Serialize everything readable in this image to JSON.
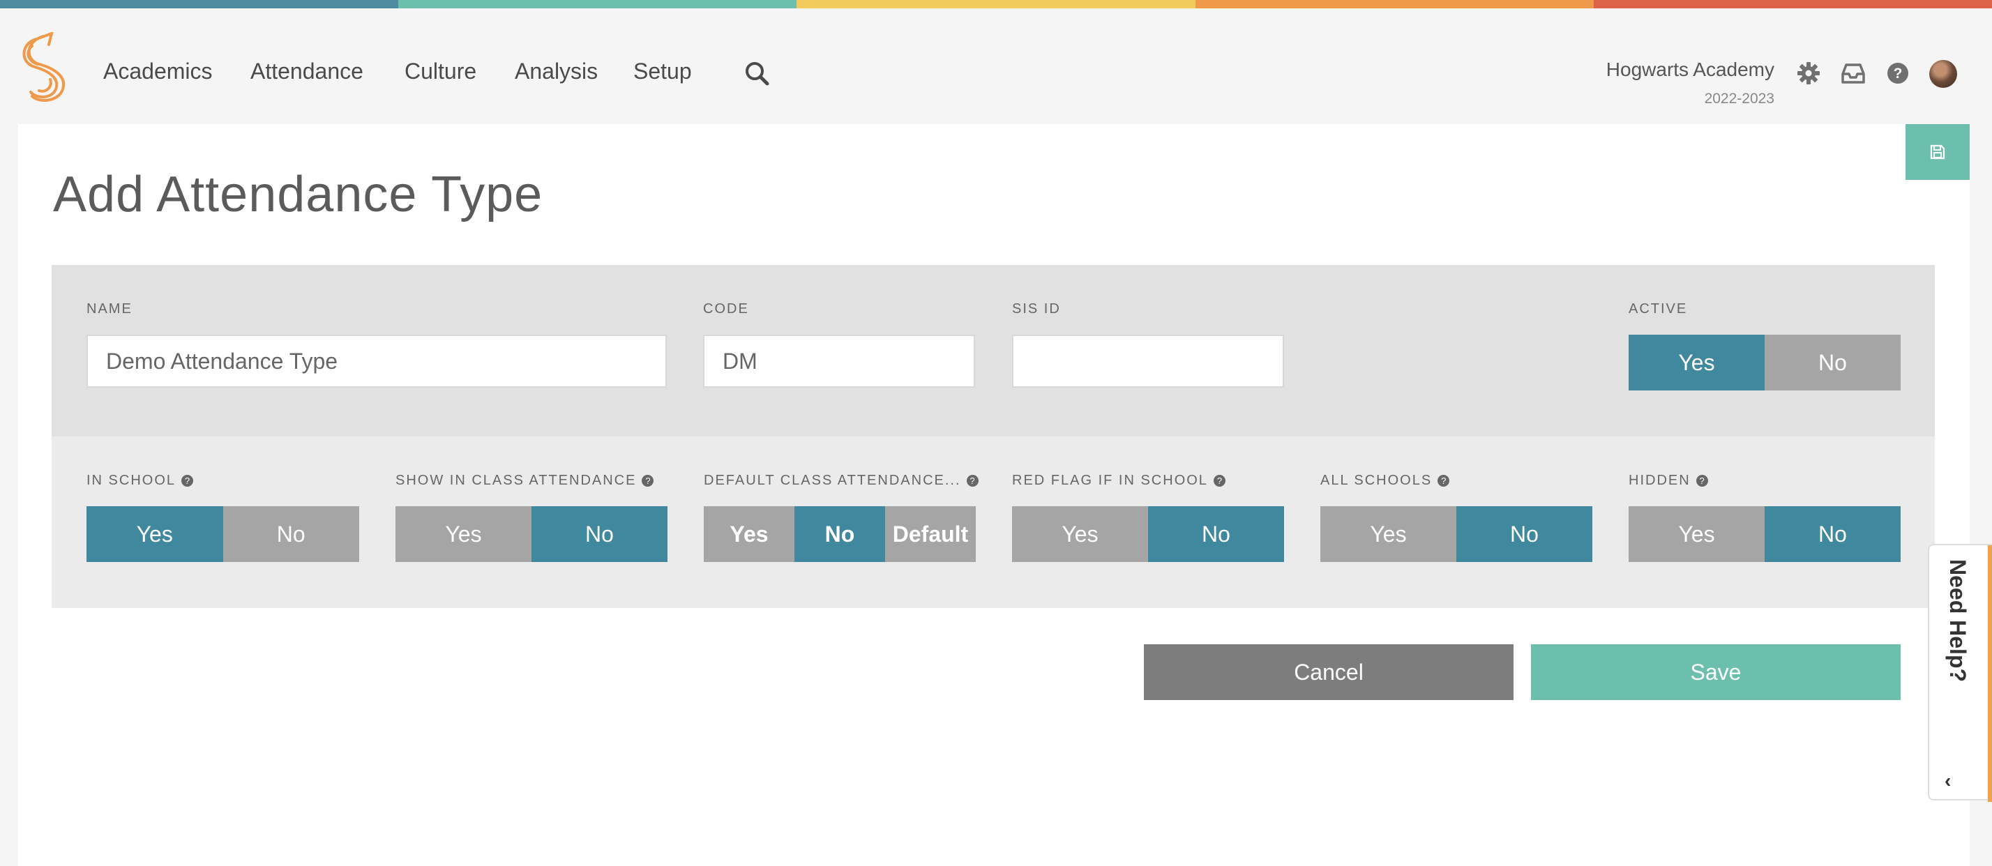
{
  "colors": {
    "stripe": [
      "#4e8aa0",
      "#6dbfad",
      "#f2cb5f",
      "#ef9a4a",
      "#dd6248"
    ],
    "accent_teal": "#3f889e",
    "save_green": "#6dbfad",
    "toggle_off": "#a5a5a5",
    "logo_orange": "#ef9a4a"
  },
  "nav": {
    "items": [
      {
        "label": "Academics"
      },
      {
        "label": "Attendance"
      },
      {
        "label": "Culture"
      },
      {
        "label": "Analysis"
      },
      {
        "label": "Setup"
      }
    ],
    "search_icon": "search-icon",
    "school_name": "Hogwarts Academy",
    "school_year": "2022-2023",
    "tools": [
      "gear-icon",
      "inbox-icon",
      "help-circle-icon",
      "avatar"
    ]
  },
  "page": {
    "title": "Add Attendance Type",
    "save_icon": "floppy-disk-icon"
  },
  "form": {
    "name": {
      "label": "NAME",
      "value": "Demo Attendance Type"
    },
    "code": {
      "label": "CODE",
      "value": "DM"
    },
    "sis_id": {
      "label": "SIS ID",
      "value": ""
    },
    "active": {
      "label": "ACTIVE",
      "options": [
        "Yes",
        "No"
      ],
      "selected": "Yes"
    },
    "in_school": {
      "label": "IN SCHOOL",
      "options": [
        "Yes",
        "No"
      ],
      "selected": "Yes"
    },
    "show_in_class": {
      "label": "SHOW IN CLASS ATTENDANCE",
      "options": [
        "Yes",
        "No"
      ],
      "selected": "No"
    },
    "default_class": {
      "label": "DEFAULT CLASS ATTENDANCE...",
      "options": [
        "Yes",
        "No",
        "Default"
      ],
      "selected": "No"
    },
    "red_flag": {
      "label": "RED FLAG IF IN SCHOOL",
      "options": [
        "Yes",
        "No"
      ],
      "selected": "No"
    },
    "all_schools": {
      "label": "ALL SCHOOLS",
      "options": [
        "Yes",
        "No"
      ],
      "selected": "No"
    },
    "hidden": {
      "label": "HIDDEN",
      "options": [
        "Yes",
        "No"
      ],
      "selected": "No"
    }
  },
  "actions": {
    "cancel": "Cancel",
    "save": "Save"
  },
  "help_tab": {
    "label": "Need Help?"
  }
}
